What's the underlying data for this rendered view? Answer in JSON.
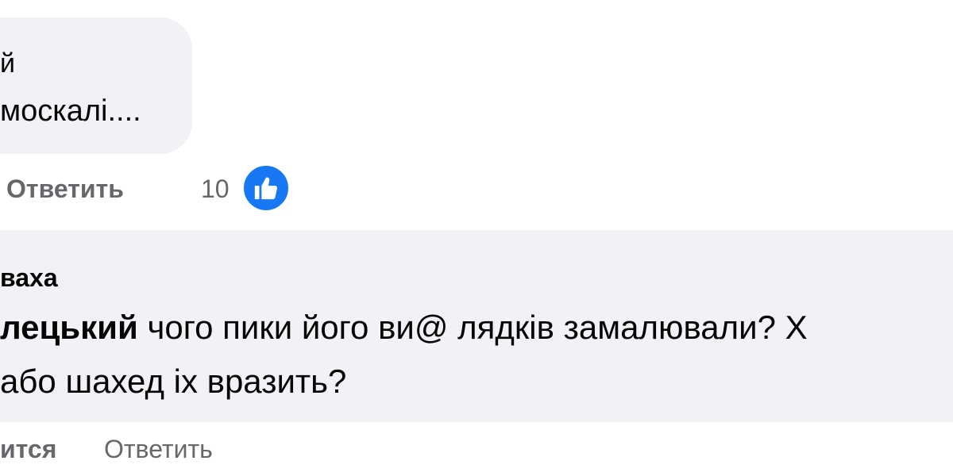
{
  "comment_top": {
    "line1": "й",
    "line2": "москалі....",
    "reply_label": "Ответить",
    "like_count": "10",
    "reaction_icon": "thumbs-up-icon",
    "reaction_color": "#1877f2"
  },
  "comment_bottom": {
    "author": "ваха",
    "mention": "лецький",
    "text_line1": " чого пики його ви@ лядків замалювали? Х",
    "text_line2": "або шахед іх вразить?",
    "like_label": "ится",
    "reply_label": "Ответить"
  },
  "colors": {
    "bubble": "#f0f2f5",
    "secondary_text": "#65676b",
    "primary_text": "#050505"
  }
}
